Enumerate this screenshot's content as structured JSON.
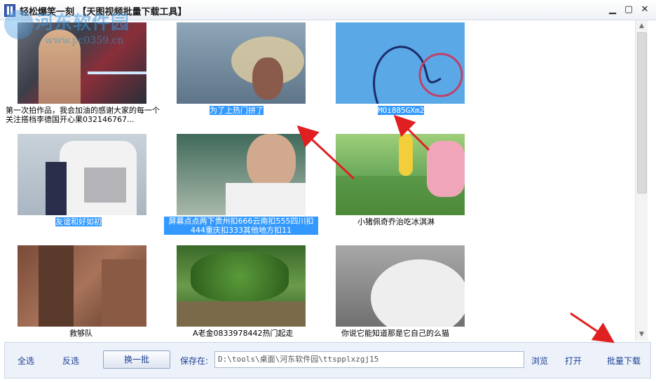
{
  "window": {
    "title": "轻松爆笑一刻 【天图视频批量下载工具】",
    "minimize": "▁",
    "maximize": "▢",
    "close": "✕"
  },
  "watermark": {
    "text": "河东软件园",
    "url": "www.pc0359.cn"
  },
  "videos": [
    {
      "caption": "第一次拍作品，我会加油的感谢大家的每一个关注搭档李德国开心果032146767...",
      "selected": false
    },
    {
      "caption": "为了上热门拼了",
      "selected": true
    },
    {
      "caption": "MOi885GXm2",
      "selected": true
    },
    {
      "caption": "友谊和好如初",
      "selected": true
    },
    {
      "caption": "屏幕点点两下贵州扣666云南扣555四川扣444重庆扣333其他地方扣11",
      "selected": true
    },
    {
      "caption": "小猪佩奇乔治吃冰淇淋",
      "selected": false
    },
    {
      "caption": "救够队",
      "selected": false
    },
    {
      "caption": "A老金0833978442热门起走",
      "selected": false
    },
    {
      "caption": "你说它能知道那是它自己的么猫",
      "selected": false
    }
  ],
  "toolbar": {
    "select_all": "全选",
    "invert": "反选",
    "next_batch": "换一批",
    "save_to_label": "保存在:",
    "save_path": "D:\\tools\\桌面\\河东软件园\\ttspplxzgj15",
    "browse": "浏览",
    "open": "打开",
    "batch_download": "批量下载"
  },
  "colors": {
    "selection": "#3399ff",
    "annotation_arrow": "#e02020",
    "link_text": "#1c3f94"
  }
}
